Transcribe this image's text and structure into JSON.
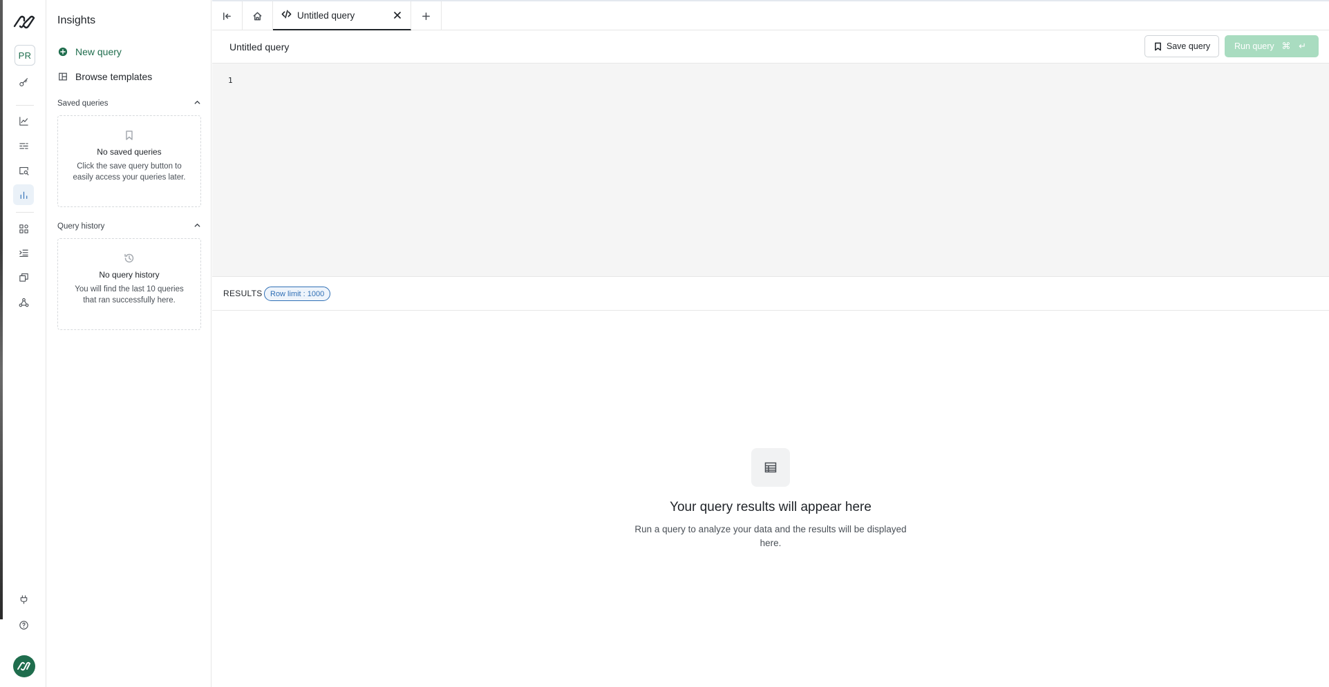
{
  "rail": {
    "profile_initials": "PR",
    "icons": [
      "logo-icon",
      "key-icon",
      "line-chart-icon",
      "filter-lines-icon",
      "search-screen-icon",
      "bar-chart-icon",
      "dashboard-grid-icon",
      "list-indent-icon",
      "copy-window-icon",
      "webhook-icon",
      "plug-icon",
      "help-icon"
    ],
    "active_icon": "bar-chart-icon",
    "active_color": "#2f6fb5"
  },
  "sidebar": {
    "title": "Insights",
    "new_query_label": "New query",
    "browse_templates_label": "Browse templates",
    "saved_queries": {
      "header": "Saved queries",
      "empty_title": "No saved queries",
      "empty_desc": "Click the save query button to easily access your queries later."
    },
    "query_history": {
      "header": "Query history",
      "empty_title": "No query history",
      "empty_desc": "You will find the last 10 queries that ran successfully here."
    }
  },
  "tabs": {
    "active_tab_label": "Untitled query"
  },
  "query": {
    "title": "Untitled query",
    "save_label": "Save query",
    "run_label": "Run query",
    "run_shortcut": "⌘ ↵",
    "line_number": "1"
  },
  "results": {
    "title": "RESULTS",
    "row_limit_badge": "Row limit : 1000",
    "empty_title": "Your query results will appear here",
    "empty_desc": "Run a query to analyze your data and the results will be displayed here."
  },
  "colors": {
    "brand_green": "#1f6d4d",
    "run_button_disabled": "#a9dcc0",
    "badge_blue": "#2f6fb5"
  }
}
